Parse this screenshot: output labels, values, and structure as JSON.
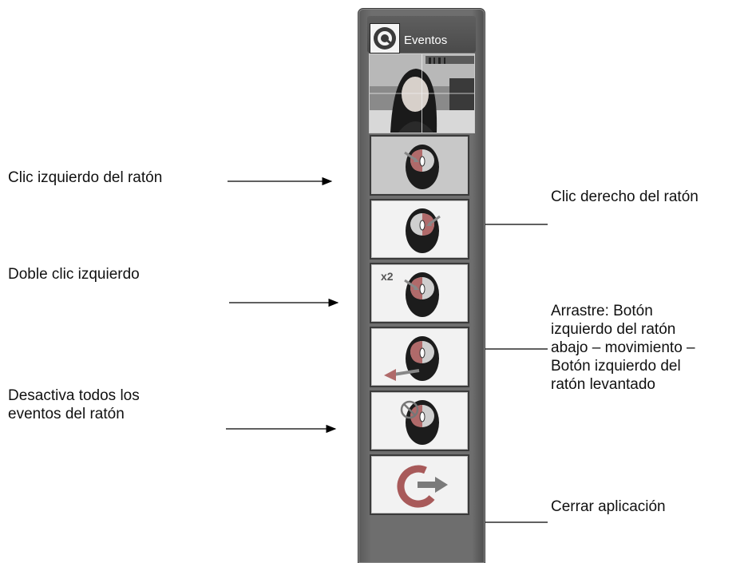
{
  "panel": {
    "title": "Eventos",
    "buttons": [
      {
        "name": "left-click",
        "active": true
      },
      {
        "name": "right-click",
        "active": false
      },
      {
        "name": "double-click",
        "badge": "x2",
        "active": false
      },
      {
        "name": "drag",
        "active": false
      },
      {
        "name": "disable-events",
        "active": false
      },
      {
        "name": "close-app",
        "active": false
      }
    ]
  },
  "annotations": {
    "left_click": "Clic izquierdo del ratón",
    "right_click": "Clic derecho del ratón",
    "double_click": "Doble clic izquierdo",
    "drag": [
      "Arrastre: Botón",
      "izquierdo del ratón",
      "abajo – movimiento –",
      "Botón izquierdo del",
      "ratón levantado"
    ],
    "disable": [
      "Desactiva todos los",
      "eventos del ratón"
    ],
    "close": "Cerrar aplicación"
  },
  "colors": {
    "panel": "#6e6e6e",
    "button_bg": "#f2f2f2",
    "button_active_bg": "#c8c8c8",
    "mouse_body": "#1c1c1c",
    "mouse_highlight": "#c06060"
  }
}
